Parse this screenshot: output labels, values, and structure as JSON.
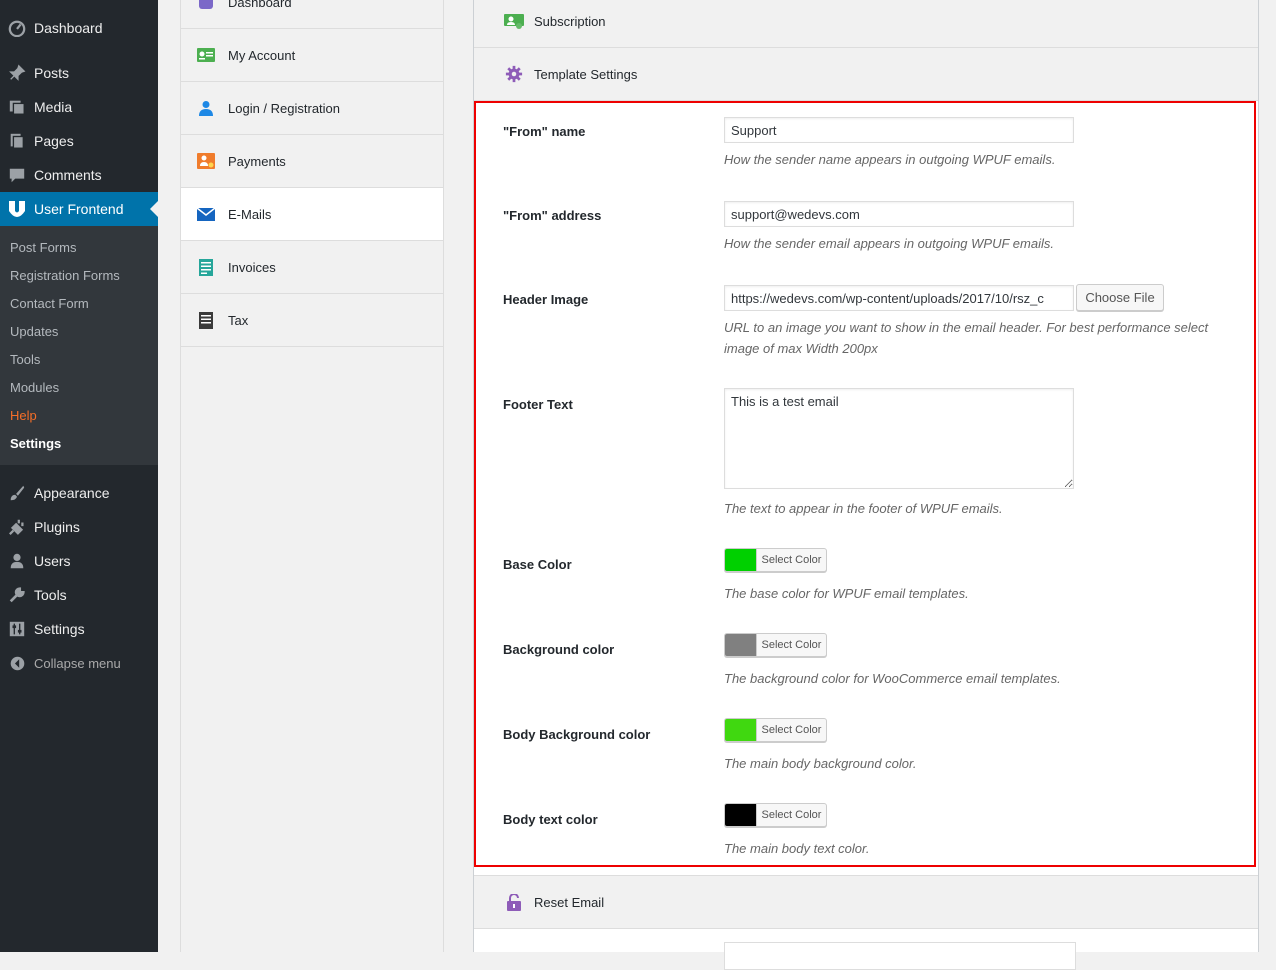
{
  "admin_menu": {
    "dashboard": "Dashboard",
    "posts": "Posts",
    "media": "Media",
    "pages": "Pages",
    "comments": "Comments",
    "user_frontend": "User Frontend",
    "submenu": [
      "Post Forms",
      "Registration Forms",
      "Contact Form",
      "Updates",
      "Tools",
      "Modules",
      "Help",
      "Settings"
    ],
    "appearance": "Appearance",
    "plugins": "Plugins",
    "users": "Users",
    "tools": "Tools",
    "settings": "Settings",
    "collapse": "Collapse menu"
  },
  "settings_tabs": [
    "Dashboard",
    "My Account",
    "Login / Registration",
    "Payments",
    "E-Mails",
    "Invoices",
    "Tax"
  ],
  "active_tab": "E-Mails",
  "sections": {
    "subscription": "Subscription",
    "template_settings": "Template Settings",
    "reset_email": "Reset Email"
  },
  "form": {
    "from_name": {
      "label": "\"From\" name",
      "value": "Support",
      "desc": "How the sender name appears in outgoing WPUF emails."
    },
    "from_address": {
      "label": "\"From\" address",
      "value": "support@wedevs.com",
      "desc": "How the sender email appears in outgoing WPUF emails."
    },
    "header_image": {
      "label": "Header Image",
      "value": "https://wedevs.com/wp-content/uploads/2017/10/rsz_c",
      "button": "Choose File",
      "desc": "URL to an image you want to show in the email header. For best performance select image of max Width 200px"
    },
    "footer_text": {
      "label": "Footer Text",
      "value": "This is a test email",
      "desc": "The text to appear in the footer of WPUF emails."
    },
    "base_color": {
      "label": "Base Color",
      "color": "#00d000",
      "button": "Select Color",
      "desc": "The base color for WPUF email templates."
    },
    "background_color": {
      "label": "Background color",
      "color": "#808080",
      "button": "Select Color",
      "desc": "The background color for WooCommerce email templates."
    },
    "body_background_color": {
      "label": "Body Background color",
      "color": "#40d810",
      "button": "Select Color",
      "desc": "The main body background color."
    },
    "body_text_color": {
      "label": "Body text color",
      "color": "#000000",
      "button": "Select Color",
      "desc": "The main body text color."
    }
  },
  "colors": {
    "sidebar_bg": "#23282d",
    "sidebar_active": "#0073aa",
    "highlight_border": "#ee0000"
  }
}
